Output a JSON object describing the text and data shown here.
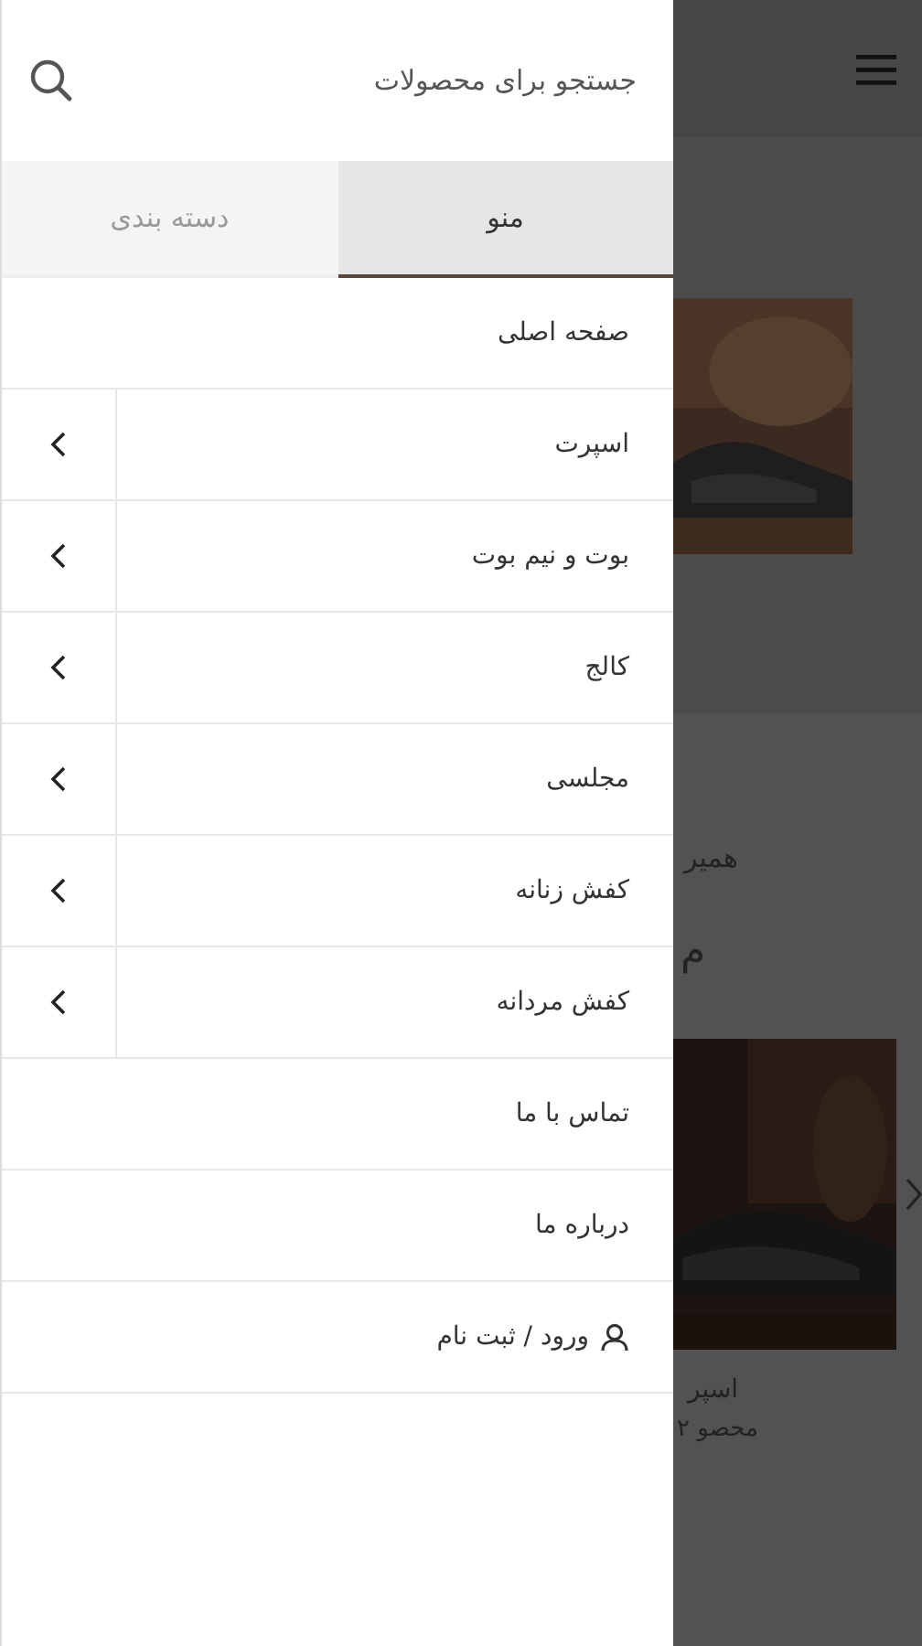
{
  "drawer": {
    "search": {
      "placeholder": "جستجو برای محصولات"
    },
    "tabs": [
      {
        "label": "منو",
        "selected": true
      },
      {
        "label": "دسته بندی",
        "selected": false
      }
    ],
    "items": [
      {
        "label": "صفحه اصلی",
        "kind": "link"
      },
      {
        "label": "اسپرت",
        "kind": "submenu"
      },
      {
        "label": "بوت و نیم بوت",
        "kind": "submenu"
      },
      {
        "label": "کالج",
        "kind": "submenu"
      },
      {
        "label": "مجلسی",
        "kind": "submenu"
      },
      {
        "label": "کفش زنانه",
        "kind": "submenu"
      },
      {
        "label": "کفش مردانه",
        "kind": "submenu"
      },
      {
        "label": "تماس با ما",
        "kind": "link"
      },
      {
        "label": "درباره ما",
        "kind": "link"
      },
      {
        "label": "ورود / ثبت نام",
        "kind": "account"
      }
    ]
  },
  "page_behind": {
    "subtitle": "همیر",
    "heading": "م",
    "product": {
      "kind": "picture",
      "name": "اسپر",
      "count": "۲ محصو"
    }
  }
}
